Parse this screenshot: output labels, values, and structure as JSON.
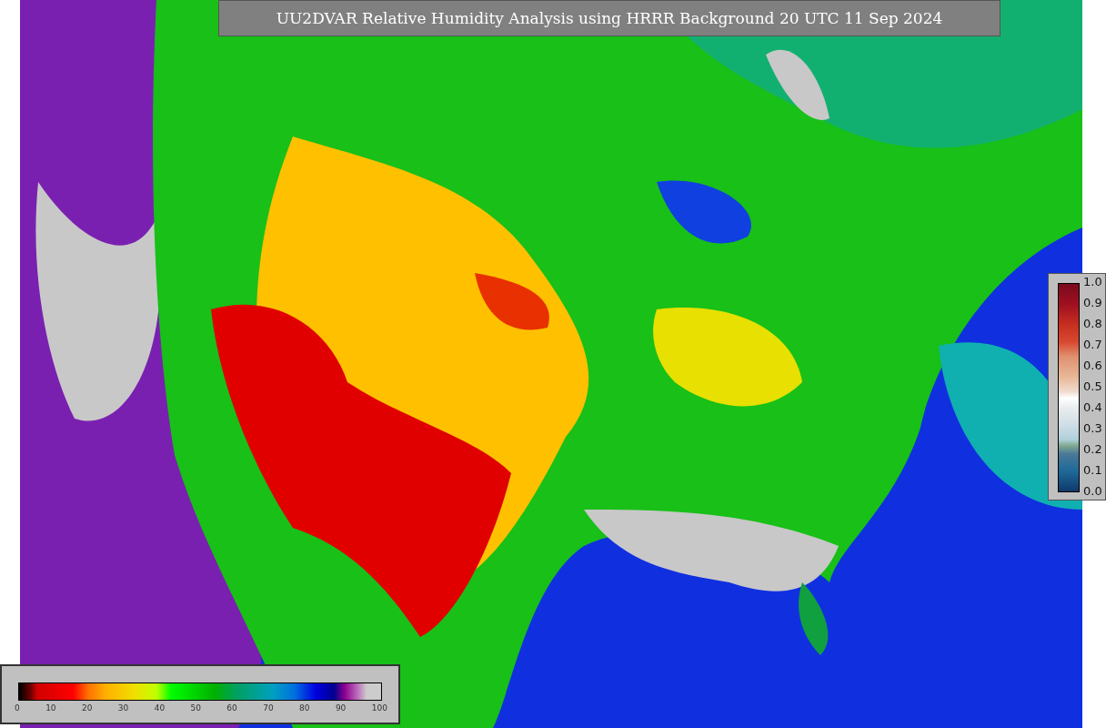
{
  "title": "UU2DVAR Relative Humidity Analysis using HRRR Background 20 UTC 11 Sep 2024",
  "humidity_colorbar": {
    "ticks": [
      "0",
      "10",
      "20",
      "30",
      "40",
      "50",
      "60",
      "70",
      "80",
      "90",
      "100"
    ]
  },
  "observation_colorbar": {
    "ticks": [
      "1.0",
      "0.9",
      "0.8",
      "0.7",
      "0.6",
      "0.5",
      "0.4",
      "0.3",
      "0.2",
      "0.1",
      "0.0"
    ]
  }
}
